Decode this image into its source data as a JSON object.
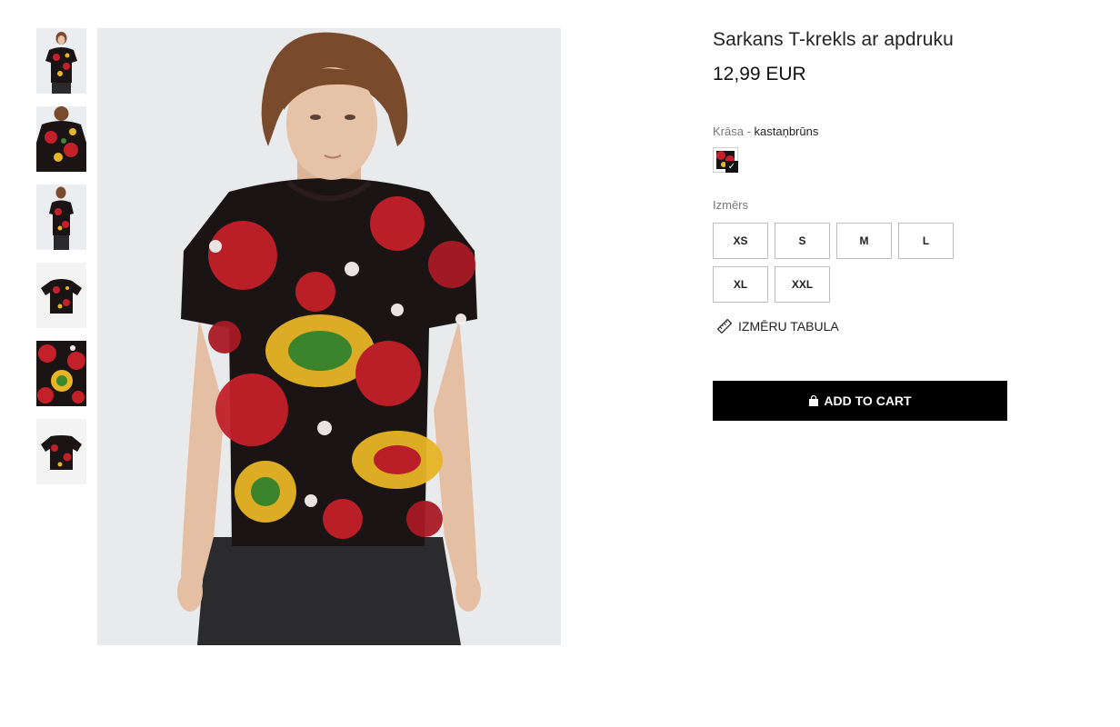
{
  "product": {
    "title": "Sarkans T-krekls ar apdruku",
    "price": "12,99 EUR"
  },
  "color": {
    "label": "Krāsa - ",
    "value": "kastaņbrūns",
    "swatch_color": "#b3262b"
  },
  "size": {
    "label": "Izmērs",
    "options": [
      "XS",
      "S",
      "M",
      "L",
      "XL",
      "XXL"
    ]
  },
  "size_table_label": "IZMĒRU TABULA",
  "cart_button_label": "ADD TO CART",
  "gallery": {
    "thumbnails": [
      "model-front",
      "model-back",
      "model-side",
      "shirt-flat-front",
      "print-detail",
      "shirt-flat-back"
    ],
    "active_index": 0
  },
  "colors": {
    "shirt_base": "#1a1414",
    "print_red": "#c3202a",
    "print_yellow": "#e8b526",
    "print_green": "#3d8a2e",
    "button_bg": "#000000"
  }
}
